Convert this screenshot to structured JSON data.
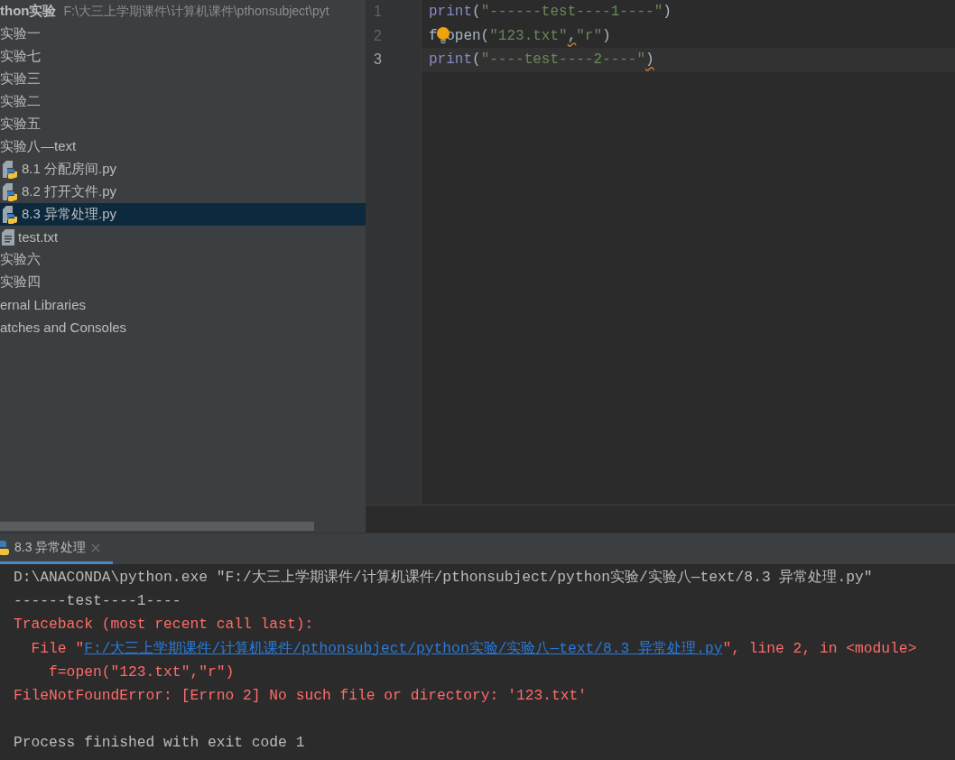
{
  "project_tree": {
    "root": {
      "name": "thon实验",
      "path": "F:\\大三上学期课件\\计算机课件\\pthonsubject\\pyt"
    },
    "items": [
      {
        "label": "实验一",
        "selected": false
      },
      {
        "label": "实验七",
        "selected": false
      },
      {
        "label": "实验三",
        "selected": false
      },
      {
        "label": "实验二",
        "selected": false
      },
      {
        "label": "实验五",
        "selected": false
      },
      {
        "label": "实验八—text",
        "selected": false,
        "children": [
          {
            "label": "8.1 分配房间.py",
            "kind": "python",
            "selected": false
          },
          {
            "label": "8.2 打开文件.py",
            "kind": "python",
            "selected": false
          },
          {
            "label": "8.3 异常处理.py",
            "kind": "python",
            "selected": true
          },
          {
            "label": "test.txt",
            "kind": "text",
            "selected": false
          }
        ]
      },
      {
        "label": "实验六",
        "selected": false
      },
      {
        "label": "实验四",
        "selected": false
      },
      {
        "label": "ernal Libraries",
        "selected": false
      },
      {
        "label": "atches and Consoles",
        "selected": false
      }
    ]
  },
  "editor": {
    "lines": [
      {
        "number": "1",
        "current": false,
        "tokens": [
          {
            "kind": "func",
            "text": "print",
            "warning": false
          },
          {
            "kind": "paren",
            "text": "(",
            "warning": false
          },
          {
            "kind": "string",
            "text": "\"------test----1----\"",
            "warning": false
          },
          {
            "kind": "paren",
            "text": ")",
            "warning": false
          }
        ]
      },
      {
        "number": "2",
        "current": false,
        "tokens": [
          {
            "kind": "plain",
            "text": "f",
            "warning": false
          },
          {
            "kind": "bulb"
          },
          {
            "kind": "plain",
            "text": "open",
            "warning": false
          },
          {
            "kind": "paren",
            "text": "(",
            "warning": false
          },
          {
            "kind": "string",
            "text": "\"123.txt\"",
            "warning": false
          },
          {
            "kind": "plain",
            "text": ",",
            "warning": true
          },
          {
            "kind": "string",
            "text": "\"r\"",
            "warning": false
          },
          {
            "kind": "paren",
            "text": ")",
            "warning": false
          }
        ]
      },
      {
        "number": "3",
        "current": true,
        "tokens": [
          {
            "kind": "func",
            "text": "print",
            "warning": false
          },
          {
            "kind": "paren",
            "text": "(",
            "warning": false
          },
          {
            "kind": "string",
            "text": "\"----test----2----\"",
            "warning": false
          },
          {
            "kind": "paren",
            "text": ")",
            "warning": true
          }
        ]
      }
    ]
  },
  "run_panel": {
    "tabs": [
      {
        "label": "8.3 异常处理",
        "selected": true
      }
    ],
    "lines": [
      {
        "kind": "text",
        "segments": [
          {
            "kind": "normal",
            "text": "D:\\ANACONDA\\python.exe \"F:/大三上学期课件/计算机课件/pthonsubject/python实验/实验八—text/8.3 异常处理.py\""
          }
        ]
      },
      {
        "kind": "text",
        "segments": [
          {
            "kind": "normal",
            "text": "------test----1----"
          }
        ]
      },
      {
        "kind": "text",
        "segments": [
          {
            "kind": "error",
            "text": "Traceback (most recent call last):"
          }
        ]
      },
      {
        "kind": "text",
        "segments": [
          {
            "kind": "error",
            "text": "  File \""
          },
          {
            "kind": "link",
            "text": "F:/大三上学期课件/计算机课件/pthonsubject/python实验/实验八—text/8.3 异常处理.py"
          },
          {
            "kind": "error",
            "text": "\", line 2, in <module>"
          }
        ]
      },
      {
        "kind": "text",
        "segments": [
          {
            "kind": "error",
            "text": "    f=open(\"123.txt\",\"r\")"
          }
        ]
      },
      {
        "kind": "text",
        "segments": [
          {
            "kind": "error",
            "text": "FileNotFoundError: [Errno 2] No such file or directory: '123.txt'"
          }
        ]
      },
      {
        "kind": "blank"
      },
      {
        "kind": "text",
        "segments": [
          {
            "kind": "normal",
            "text": "Process finished with exit code 1"
          }
        ]
      }
    ]
  }
}
